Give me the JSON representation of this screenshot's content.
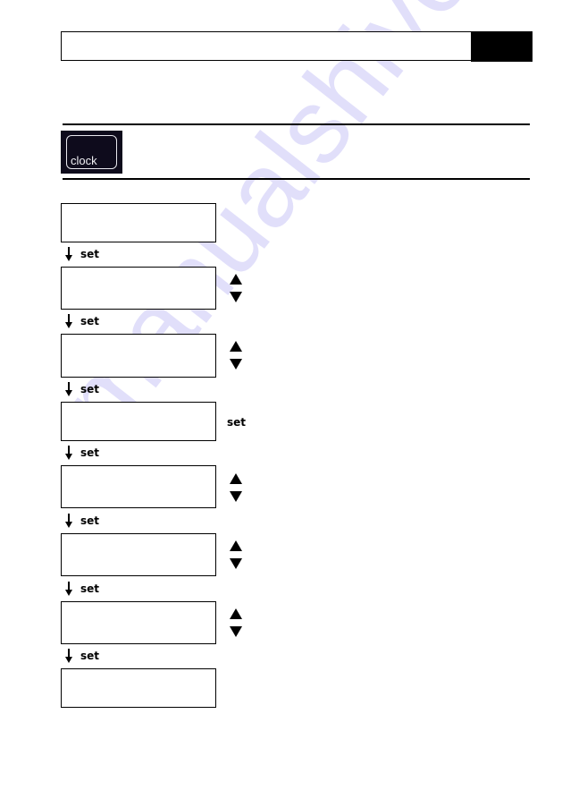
{
  "page": {
    "watermark": "manualshive.com",
    "header": {
      "title": "",
      "tab_label": ""
    }
  },
  "section": {
    "button_icon": {
      "name": "clock-button",
      "label": "clock"
    },
    "description": ""
  },
  "steps": [
    {
      "display": "",
      "control": "none"
    },
    {
      "display": "",
      "control": "up-down",
      "advance_label": "set"
    },
    {
      "display": "",
      "control": "up-down",
      "advance_label": "set"
    },
    {
      "display": "",
      "control": "set",
      "control_label": "set",
      "advance_label": "set"
    },
    {
      "display": "",
      "control": "up-down",
      "advance_label": "set"
    },
    {
      "display": "",
      "control": "up-down",
      "advance_label": "set"
    },
    {
      "display": "",
      "control": "up-down",
      "advance_label": "set"
    },
    {
      "display": "",
      "control": "none",
      "advance_label": "set"
    }
  ],
  "transitions": [
    {
      "label": "set"
    },
    {
      "label": "set"
    },
    {
      "label": "set"
    },
    {
      "label": "set"
    },
    {
      "label": "set"
    },
    {
      "label": "set"
    },
    {
      "label": "set"
    }
  ],
  "colors": {
    "ink": "#000000",
    "button_bg": "#0e0b1c",
    "watermark": "#c9c6f6"
  }
}
